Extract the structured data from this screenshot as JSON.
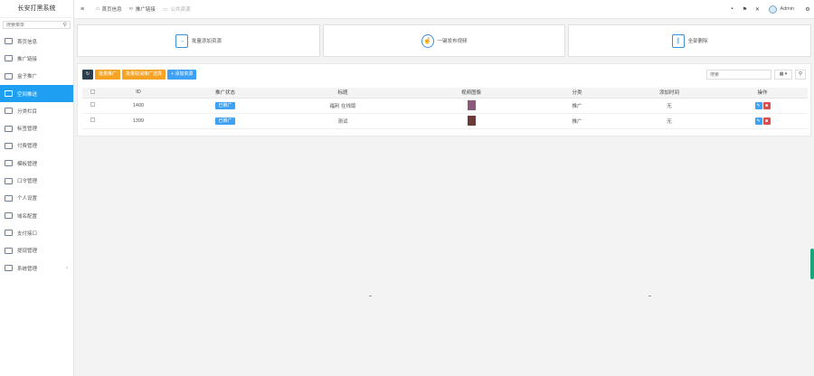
{
  "sidebar": {
    "brand": "长安打黑系统",
    "search_placeholder": "搜索菜单",
    "items": [
      {
        "label": "首页信息",
        "icon": "dashboard-icon"
      },
      {
        "label": "推广链接",
        "icon": "link-icon"
      },
      {
        "label": "盒子推广",
        "icon": "box-icon"
      },
      {
        "label": "空间推送",
        "icon": "push-icon",
        "active": true
      },
      {
        "label": "分类栏目",
        "icon": "category-icon"
      },
      {
        "label": "标签管理",
        "icon": "tag-icon"
      },
      {
        "label": "付费管理",
        "icon": "payment-icon"
      },
      {
        "label": "模板管理",
        "icon": "template-icon"
      },
      {
        "label": "口令管理",
        "icon": "password-icon"
      },
      {
        "label": "个人设置",
        "icon": "user-settings-icon"
      },
      {
        "label": "域名配置",
        "icon": "domain-icon"
      },
      {
        "label": "支付接口",
        "icon": "pay-api-icon"
      },
      {
        "label": "提现管理",
        "icon": "withdraw-icon"
      },
      {
        "label": "系统管理",
        "icon": "system-icon",
        "has_arrow": true
      }
    ]
  },
  "topbar": {
    "tabs": [
      {
        "label": "首页信息",
        "icon": "home-icon"
      },
      {
        "label": "推广链接",
        "icon": "link-icon"
      },
      {
        "label": "公共资源",
        "icon": "folder-icon",
        "muted": true
      }
    ],
    "user": "Admin"
  },
  "cards": [
    {
      "label": "批量添加资源",
      "icon": "import-icon"
    },
    {
      "label": "一键发布视频",
      "icon": "tap-icon"
    },
    {
      "label": "全部删除",
      "icon": "trash-icon"
    }
  ],
  "toolbar": {
    "btn1": "批量推广",
    "btn2": "批量取消推广选择",
    "btn3": "+ 添加资源",
    "search_placeholder": "搜索"
  },
  "table": {
    "headers": [
      "ID",
      "推广状态",
      "标题",
      "视频图像",
      "分类",
      "添加时间",
      "操作"
    ],
    "rows": [
      {
        "id": "1400",
        "status": "已推广",
        "title": "福利 在线版",
        "thumb_color": "#8a5a7a",
        "category": "推广",
        "time": "无"
      },
      {
        "id": "1399",
        "status": "已推广",
        "title": "测试",
        "thumb_color": "#6b3a3a",
        "category": "推广",
        "time": "无"
      }
    ]
  },
  "colors": {
    "accent": "#1e9ff2",
    "orange": "#f4a325",
    "danger": "#e04b4b"
  }
}
